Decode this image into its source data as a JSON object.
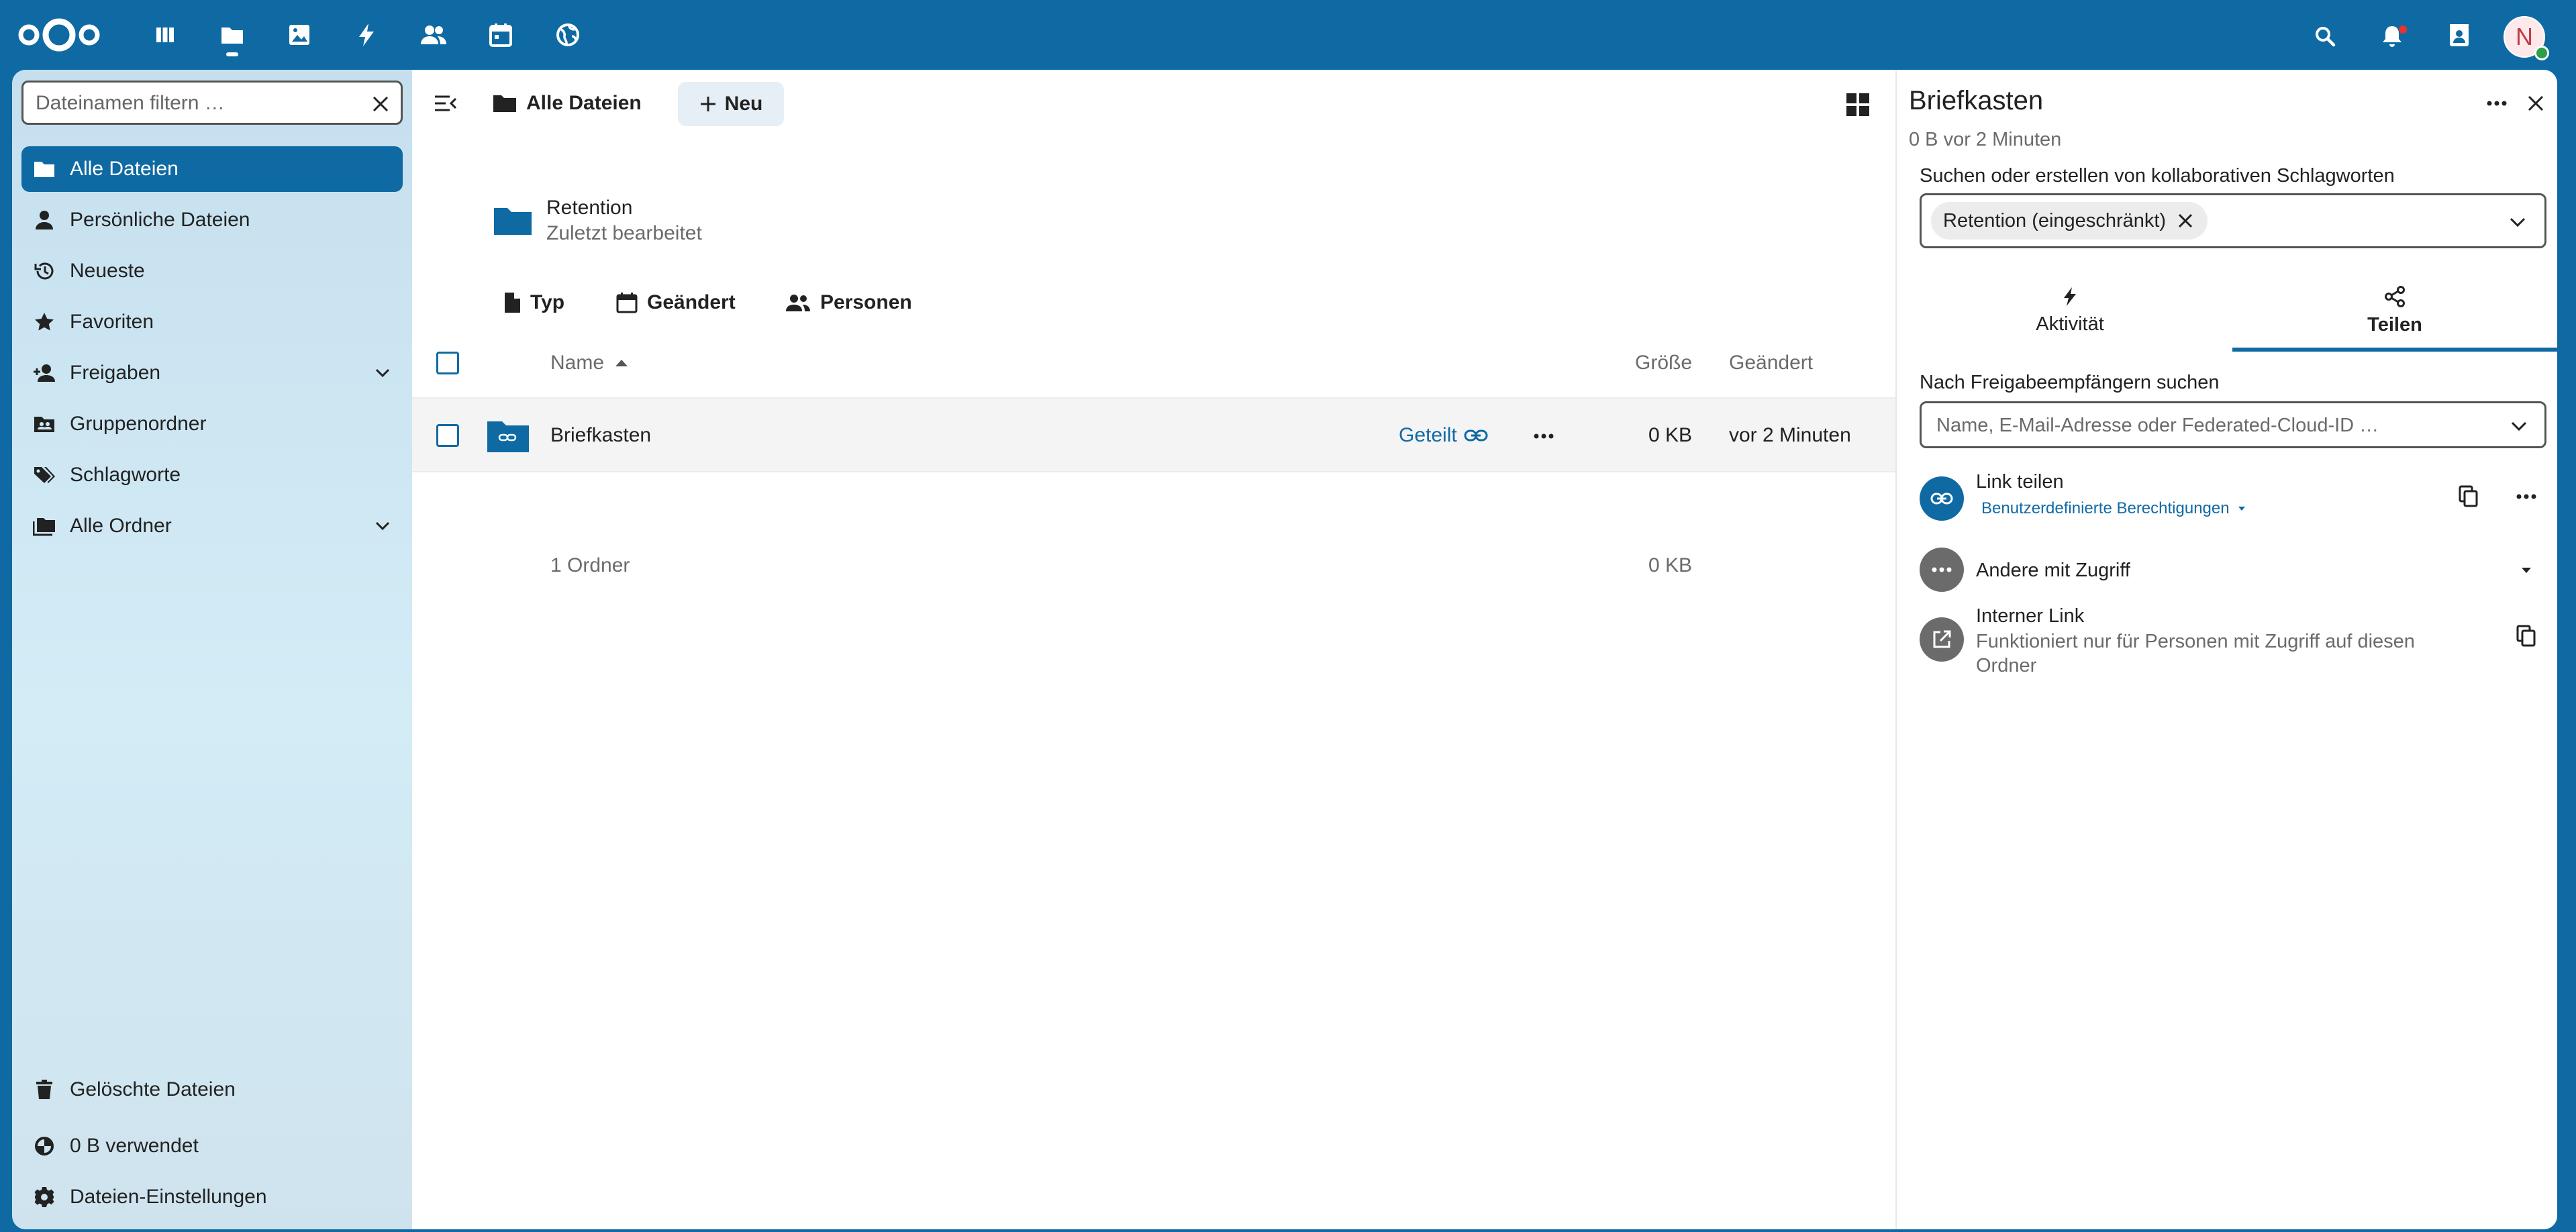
{
  "topbar": {
    "apps": [
      "dashboard-icon",
      "files-icon",
      "photos-icon",
      "activity-icon",
      "contacts-icon",
      "calendar-icon",
      "circles-icon"
    ],
    "avatar_initial": "N"
  },
  "left_nav": {
    "filter": {
      "placeholder": "Dateinamen filtern …"
    },
    "items": [
      {
        "label": "Alle Dateien",
        "icon": "folder-icon",
        "active": true
      },
      {
        "label": "Persönliche Dateien",
        "icon": "person-icon"
      },
      {
        "label": "Neueste",
        "icon": "history-icon"
      },
      {
        "label": "Favoriten",
        "icon": "star-icon"
      },
      {
        "label": "Freigaben",
        "icon": "share-person-icon",
        "expandable": true
      },
      {
        "label": "Gruppenordner",
        "icon": "group-folder-icon"
      },
      {
        "label": "Schlagworte",
        "icon": "tag-icon"
      },
      {
        "label": "Alle Ordner",
        "icon": "folders-icon",
        "expandable": true
      }
    ],
    "bottom": {
      "trash": "Gelöschte Dateien",
      "quota": "0 B verwendet",
      "settings": "Dateien-Einstellungen"
    }
  },
  "main": {
    "breadcrumb": "Alle Dateien",
    "new_button": "Neu",
    "recent": {
      "name": "Retention",
      "subtitle": "Zuletzt bearbeitet"
    },
    "filters": {
      "type": "Typ",
      "modified": "Geändert",
      "people": "Personen"
    },
    "table": {
      "headers": {
        "name": "Name",
        "size": "Größe",
        "modified": "Geändert"
      },
      "rows": [
        {
          "name": "Briefkasten",
          "shared_label": "Geteilt",
          "size": "0 KB",
          "modified": "vor 2 Minuten"
        }
      ],
      "summary": {
        "count": "1 Ordner",
        "size": "0 KB"
      }
    }
  },
  "sidebar": {
    "title": "Briefkasten",
    "subtitle": "0 B vor 2 Minuten",
    "tags_label": "Suchen oder erstellen von kollaborativen Schlagworten",
    "tag": "Retention (eingeschränkt)",
    "tabs": {
      "activity": "Aktivität",
      "sharing": "Teilen"
    },
    "share_search_label": "Nach Freigabeempfängern suchen",
    "share_search_placeholder": "Name, E-Mail-Adresse oder Federated-Cloud-ID …",
    "link_share": {
      "title": "Link teilen",
      "permissions": "Benutzerdefinierte Berechtigungen"
    },
    "others": "Andere mit Zugriff",
    "internal_link": {
      "title": "Interner Link",
      "description": "Funktioniert nur für Personen mit Zugriff auf diesen Ordner"
    }
  },
  "colors": {
    "primary": "#0f6aa3",
    "nav_bg": "#cfe6f2",
    "text": "#222222",
    "muted": "#6b6b6b"
  }
}
